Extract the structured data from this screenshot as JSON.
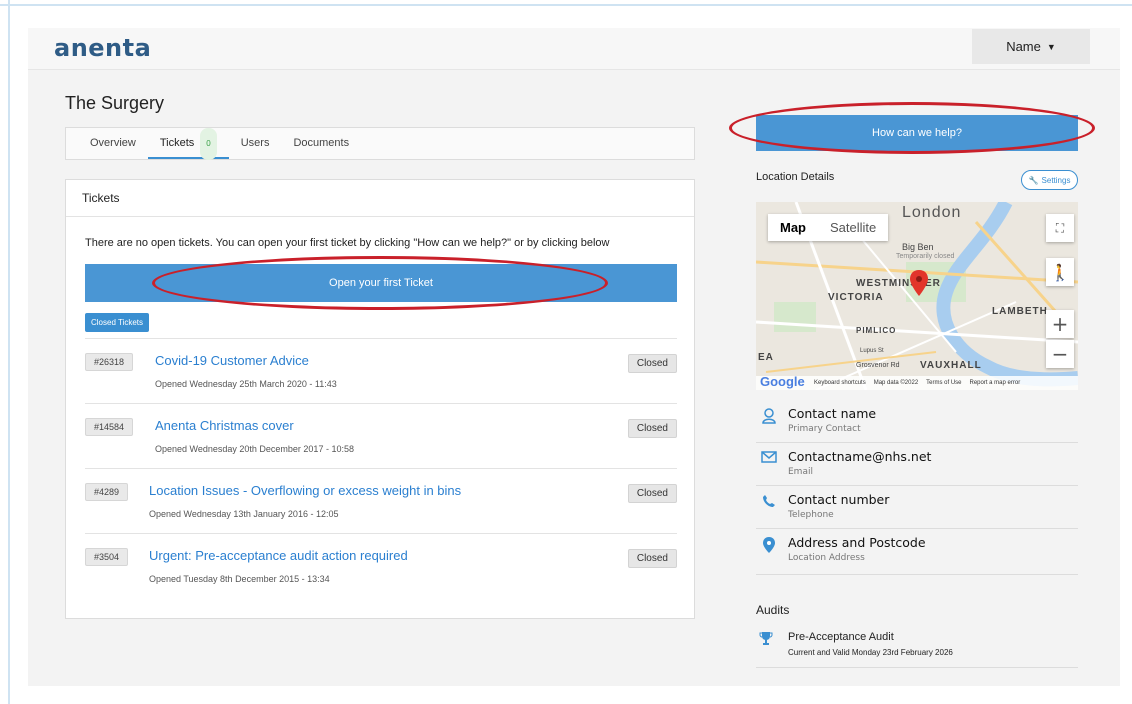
{
  "app": {
    "logo": "anenta",
    "user_menu_label": "Name"
  },
  "page": {
    "title": "The Surgery"
  },
  "tabs": [
    {
      "label": "Overview",
      "active": false
    },
    {
      "label": "Tickets",
      "badge": "0",
      "active": true
    },
    {
      "label": "Users",
      "active": false
    },
    {
      "label": "Documents",
      "active": false
    }
  ],
  "tickets_panel": {
    "header": "Tickets",
    "empty_message": "There are no open tickets. You can open your first ticket by clicking \"How can we help?\" or by clicking below",
    "open_button": "Open your first Ticket",
    "closed_tickets_button": "Closed Tickets",
    "items": [
      {
        "id": "#26318",
        "title": "Covid-19 Customer Advice",
        "opened": "Opened Wednesday 25th March 2020 - 11:43",
        "status": "Closed"
      },
      {
        "id": "#14584",
        "title": "Anenta Christmas cover",
        "opened": "Opened Wednesday 20th December 2017 - 10:58",
        "status": "Closed"
      },
      {
        "id": "#4289",
        "title": "Location Issues - Overflowing or excess weight in bins",
        "opened": "Opened Wednesday 13th January 2016 - 12:05",
        "status": "Closed"
      },
      {
        "id": "#3504",
        "title": "Urgent: Pre-acceptance audit action required",
        "opened": "Opened Tuesday 8th December 2015 - 13:34",
        "status": "Closed"
      }
    ]
  },
  "sidebar": {
    "help_button": "How can we help?",
    "location_title": "Location Details",
    "settings_label": "Settings",
    "map": {
      "map_tab": "Map",
      "satellite_tab": "Satellite",
      "labels": {
        "london": "London",
        "big_ben": "Big Ben",
        "big_ben_note": "Temporarily closed",
        "westminster": "WESTMINSTER",
        "victoria": "VICTORIA",
        "lambeth": "LAMBETH",
        "pimlico": "PIMLICO",
        "vauxhall": "VAUXHALL",
        "grosvenor": "Grosvenor Rd",
        "lupus": "Lupus St",
        "ea": "EA"
      },
      "footer": {
        "logo": "Google",
        "shortcuts": "Keyboard shortcuts",
        "map_data": "Map data ©2022",
        "terms": "Terms of Use",
        "report": "Report a map error"
      },
      "zoom_in": "+",
      "zoom_out": "−"
    },
    "contacts": [
      {
        "icon": "user-icon",
        "main": "Contact name",
        "sub": "Primary Contact"
      },
      {
        "icon": "envelope-icon",
        "main": "Contactname@nhs.net",
        "sub": "Email"
      },
      {
        "icon": "phone-icon",
        "main": "Contact number",
        "sub": "Telephone"
      },
      {
        "icon": "location-pin-icon",
        "main": "Address and Postcode",
        "sub": "Location Address"
      }
    ],
    "audits_title": "Audits",
    "audit": {
      "icon": "trophy-icon",
      "title": "Pre-Acceptance Audit",
      "status": "Current and Valid  Monday 23rd February 2026"
    }
  },
  "colors": {
    "primary": "#4a96d4",
    "link": "#2a7fd0",
    "annotation": "#c9202a",
    "logo": "#2f5c86"
  }
}
